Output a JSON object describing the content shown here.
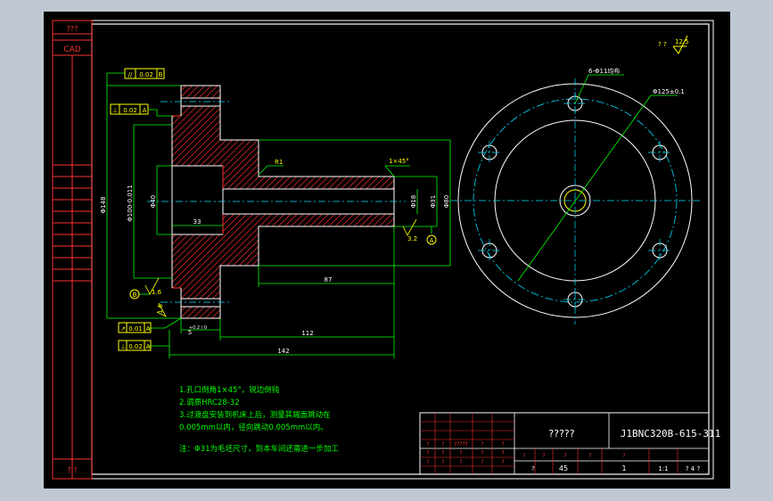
{
  "left_strip": {
    "top_mark": "???",
    "cad_label": "CAD",
    "bottom_mark": "? ?"
  },
  "roughness_top": {
    "prefix": "? ?",
    "value": "12.5"
  },
  "tolerances": {
    "flatness_top": {
      "symbol": "//",
      "value": "0.02",
      "datum": "B"
    },
    "perp_upper": {
      "symbol": "⊥",
      "value": "0.02",
      "datum": "A"
    },
    "runout_lower": {
      "symbol": "↗",
      "value": "0.01",
      "datum": "A"
    },
    "perp_lower": {
      "symbol": "⊥",
      "value": "0.02",
      "datum": "A"
    }
  },
  "dimensions": {
    "d148": "Φ148",
    "d100": "Φ100-0.011",
    "d40": "Φ40",
    "d33": "33",
    "d18": "Φ18",
    "d31": "Φ31",
    "d80": "Φ80",
    "d87": "87",
    "d112": "112",
    "d142": "142",
    "d5": "5",
    "r1": "R1",
    "chamfer": "1×45°",
    "holes": "6-Φ11均布",
    "pcd": "Φ125±0.1",
    "rough1": "1.6",
    "rough2": "3.2",
    "rough3": "1.6",
    "tol_small": "+0.2 / 0",
    "datum_a": "A",
    "datum_b": "B"
  },
  "notes": [
    "1.孔口倒角1×45°，锐边倒钝",
    "2.调质HRC28-32",
    "3.过渡盘安装到机床上后，测量其端面跳动在",
    "0.005mm以内，径向跳动0.005mm以内。",
    "注：Φ31为毛坯尺寸，到本车间还需进一步加工"
  ],
  "title_block": {
    "part_name": "?????",
    "drawing_no": "J1BNC320B-615-311",
    "material": "45",
    "quantity": "1",
    "scale": "1:1",
    "row1": [
      "?",
      "?",
      "?",
      "?",
      "?",
      "?",
      "?",
      "?"
    ],
    "row2_left": [
      "?",
      "?",
      "?????",
      "?",
      "?"
    ],
    "row3_left": [
      "?",
      "?",
      "?",
      "?",
      "?"
    ],
    "row4_left": [
      "?",
      "?",
      "?",
      "?",
      "?"
    ],
    "small_marks": [
      "?",
      "?",
      "?",
      "?",
      "?",
      "?",
      "?",
      "?"
    ],
    "col_labels": [
      "?",
      "?",
      "?",
      "?",
      "?"
    ],
    "qty_mark": "?",
    "mat_mark": "?",
    "page": "? 4 ?"
  }
}
